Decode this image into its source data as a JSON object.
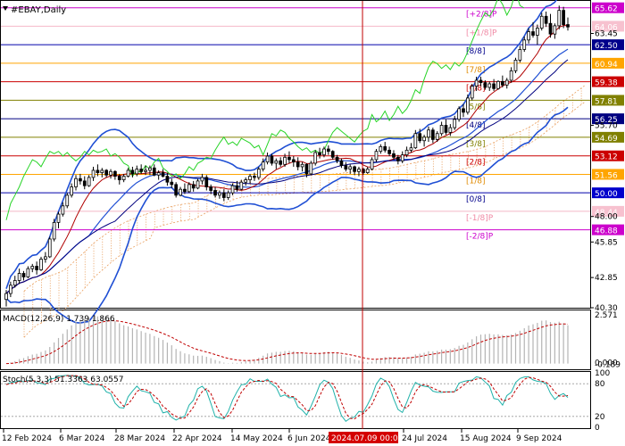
{
  "chart_data": {
    "type": "candlestick",
    "title": "#EBAY,Daily",
    "price_axis": {
      "labels": [
        "65.62",
        "64.06",
        "63.45",
        "62.50",
        "60.94",
        "59.38",
        "57.81",
        "56.25",
        "55.70",
        "54.69",
        "53.12",
        "51.56",
        "50.00",
        "48.44",
        "48.00",
        "46.88",
        "45.85",
        "42.85",
        "40.30"
      ],
      "ylim": [
        40.3,
        66.2
      ]
    },
    "murrey_levels": [
      {
        "label": "[+2/8]P",
        "price": 65.62,
        "color": "#cc00cc",
        "tag_bg": "#cc00cc",
        "label_color": "#cc00cc"
      },
      {
        "label": "[+1/8]P",
        "price": 64.06,
        "color": "#f4b8c8",
        "tag_bg": "#f7c1cf",
        "label_color": "#f08aa5"
      },
      {
        "label": "[8/8]",
        "price": 62.5,
        "color": "#0000aa",
        "tag_bg": "#00008b",
        "label_color": "#00008b"
      },
      {
        "label": "[7/8]",
        "price": 60.94,
        "color": "#ffa500",
        "tag_bg": "#ffa500",
        "label_color": "#e08a00"
      },
      {
        "label": "[6/8]",
        "price": 59.38,
        "color": "#cc0000",
        "tag_bg": "#cc0000",
        "label_color": "#cc0000"
      },
      {
        "label": "[5/8]",
        "price": 57.81,
        "color": "#808000",
        "tag_bg": "#808000",
        "label_color": "#808000"
      },
      {
        "label": "[4/8]",
        "price": 56.25,
        "color": "#000080",
        "tag_bg": "#000080",
        "label_color": "#000080"
      },
      {
        "label": "[3/8]",
        "price": 54.69,
        "color": "#808000",
        "tag_bg": "#808000",
        "label_color": "#808000"
      },
      {
        "label": "[2/8]",
        "price": 53.12,
        "color": "#cc0000",
        "tag_bg": "#cc0000",
        "label_color": "#cc0000"
      },
      {
        "label": "[1/8]",
        "price": 51.56,
        "color": "#ffa500",
        "tag_bg": "#ffa500",
        "label_color": "#e08a00"
      },
      {
        "label": "[0/8]",
        "price": 50.0,
        "color": "#0000aa",
        "tag_bg": "#0000cc",
        "label_color": "#00008b"
      },
      {
        "label": "[-1/8]P",
        "price": 48.44,
        "color": "#f4b8c8",
        "tag_bg": "#f7c1cf",
        "label_color": "#f08aa5"
      },
      {
        "label": "[-2/8]P",
        "price": 46.88,
        "color": "#cc00cc",
        "tag_bg": "#cc00cc",
        "label_color": "#cc00cc"
      }
    ],
    "x_labels": [
      "12 Feb 2024",
      "6 Mar 2024",
      "28 Mar 2024",
      "22 Apr 2024",
      "14 May 2024",
      "6 Jun 2024",
      "24 Jul 2024",
      "15 Aug 2024",
      "9 Sep 2024"
    ],
    "highlight_date": "2024.07.09 00:00",
    "candles": [
      [
        41.0,
        41.8,
        40.4,
        41.5
      ],
      [
        41.5,
        42.5,
        41.2,
        42.2
      ],
      [
        42.2,
        43.0,
        42.0,
        42.6
      ],
      [
        42.6,
        43.6,
        42.3,
        43.2
      ],
      [
        43.2,
        43.4,
        42.6,
        42.9
      ],
      [
        42.9,
        43.8,
        42.8,
        43.6
      ],
      [
        43.6,
        44.0,
        43.3,
        43.8
      ],
      [
        43.8,
        44.2,
        43.1,
        43.5
      ],
      [
        43.5,
        44.6,
        43.4,
        44.4
      ],
      [
        44.4,
        45.0,
        44.1,
        44.6
      ],
      [
        44.6,
        46.3,
        44.5,
        46.1
      ],
      [
        46.1,
        47.8,
        45.9,
        47.5
      ],
      [
        47.5,
        48.4,
        47.0,
        48.2
      ],
      [
        48.2,
        49.2,
        48.0,
        48.9
      ],
      [
        48.9,
        50.0,
        48.7,
        49.8
      ],
      [
        49.8,
        50.8,
        49.6,
        50.5
      ],
      [
        50.5,
        51.5,
        50.2,
        51.2
      ],
      [
        51.2,
        51.6,
        50.7,
        51.0
      ],
      [
        51.0,
        51.4,
        50.3,
        50.6
      ],
      [
        50.6,
        51.5,
        50.5,
        51.3
      ],
      [
        51.3,
        52.2,
        51.0,
        51.9
      ],
      [
        51.9,
        52.4,
        51.4,
        51.7
      ],
      [
        51.7,
        52.1,
        51.3,
        51.9
      ],
      [
        51.9,
        52.0,
        51.3,
        51.5
      ],
      [
        51.5,
        52.0,
        51.2,
        51.8
      ],
      [
        51.8,
        51.9,
        51.1,
        51.4
      ],
      [
        51.4,
        51.6,
        50.7,
        51.1
      ],
      [
        51.1,
        51.6,
        50.9,
        51.4
      ],
      [
        51.4,
        52.1,
        51.3,
        51.9
      ],
      [
        51.9,
        52.2,
        51.3,
        51.6
      ],
      [
        51.6,
        52.3,
        51.4,
        52.0
      ],
      [
        52.0,
        52.4,
        51.6,
        51.8
      ],
      [
        51.8,
        52.3,
        51.5,
        51.9
      ],
      [
        51.9,
        52.3,
        51.5,
        52.1
      ],
      [
        52.1,
        52.4,
        51.4,
        51.5
      ],
      [
        51.5,
        51.9,
        51.1,
        51.7
      ],
      [
        51.7,
        52.0,
        51.3,
        51.4
      ],
      [
        51.4,
        51.7,
        50.6,
        50.9
      ],
      [
        50.9,
        51.2,
        50.4,
        50.7
      ],
      [
        50.7,
        50.9,
        49.6,
        49.8
      ],
      [
        49.8,
        50.5,
        49.7,
        50.3
      ],
      [
        50.3,
        50.8,
        49.9,
        50.1
      ],
      [
        50.1,
        50.9,
        50.0,
        50.7
      ],
      [
        50.7,
        51.0,
        50.1,
        50.4
      ],
      [
        50.4,
        51.2,
        50.3,
        51.0
      ],
      [
        51.0,
        51.6,
        50.7,
        51.3
      ],
      [
        51.3,
        51.5,
        50.2,
        50.5
      ],
      [
        50.5,
        50.7,
        49.9,
        50.2
      ],
      [
        50.2,
        50.5,
        49.6,
        49.8
      ],
      [
        49.8,
        50.2,
        49.5,
        50.0
      ],
      [
        50.0,
        50.3,
        49.3,
        49.6
      ],
      [
        49.6,
        50.2,
        49.4,
        50.0
      ],
      [
        50.0,
        50.8,
        49.8,
        50.6
      ],
      [
        50.6,
        51.0,
        50.1,
        50.3
      ],
      [
        50.3,
        51.1,
        50.2,
        50.9
      ],
      [
        50.9,
        51.3,
        50.6,
        51.1
      ],
      [
        51.1,
        51.6,
        50.8,
        51.4
      ],
      [
        51.4,
        51.7,
        51.0,
        51.3
      ],
      [
        51.3,
        52.2,
        51.1,
        52.0
      ],
      [
        52.0,
        52.9,
        51.8,
        52.6
      ],
      [
        52.6,
        53.4,
        52.4,
        53.1
      ],
      [
        53.1,
        53.3,
        52.3,
        52.5
      ],
      [
        52.5,
        52.9,
        52.0,
        52.7
      ],
      [
        52.7,
        53.0,
        52.2,
        52.4
      ],
      [
        52.4,
        53.3,
        52.2,
        53.0
      ],
      [
        53.0,
        53.5,
        52.5,
        52.8
      ],
      [
        52.8,
        53.1,
        52.2,
        52.6
      ],
      [
        52.6,
        53.0,
        51.9,
        52.2
      ],
      [
        52.2,
        52.6,
        51.8,
        52.4
      ],
      [
        52.4,
        52.5,
        51.3,
        51.6
      ],
      [
        51.6,
        52.7,
        51.5,
        52.5
      ],
      [
        52.5,
        53.6,
        52.3,
        53.4
      ],
      [
        53.4,
        53.8,
        52.9,
        53.2
      ],
      [
        53.2,
        53.9,
        53.0,
        53.7
      ],
      [
        53.7,
        54.0,
        53.2,
        53.5
      ],
      [
        53.5,
        53.6,
        52.8,
        53.0
      ],
      [
        53.0,
        53.2,
        52.5,
        52.7
      ],
      [
        52.7,
        52.9,
        52.1,
        52.3
      ],
      [
        52.3,
        52.6,
        51.8,
        52.0
      ],
      [
        52.0,
        52.4,
        51.6,
        52.2
      ],
      [
        52.2,
        52.3,
        51.5,
        51.8
      ],
      [
        51.8,
        52.2,
        51.4,
        52.0
      ],
      [
        52.0,
        52.1,
        51.5,
        51.7
      ],
      [
        51.7,
        52.2,
        51.6,
        52.0
      ],
      [
        52.0,
        53.0,
        51.9,
        52.8
      ],
      [
        52.8,
        53.7,
        52.6,
        53.5
      ],
      [
        53.5,
        54.1,
        53.3,
        53.9
      ],
      [
        53.9,
        54.3,
        53.4,
        53.6
      ],
      [
        53.6,
        53.9,
        53.1,
        53.3
      ],
      [
        53.3,
        53.6,
        52.8,
        53.0
      ],
      [
        53.0,
        53.2,
        52.4,
        52.7
      ],
      [
        52.7,
        53.5,
        52.5,
        53.2
      ],
      [
        53.2,
        53.9,
        53.0,
        53.6
      ],
      [
        53.6,
        54.2,
        53.4,
        53.8
      ],
      [
        53.8,
        55.3,
        53.7,
        55.0
      ],
      [
        55.0,
        55.4,
        54.2,
        54.4
      ],
      [
        54.4,
        54.9,
        53.9,
        54.7
      ],
      [
        54.7,
        55.6,
        54.3,
        55.3
      ],
      [
        55.3,
        55.5,
        54.2,
        54.5
      ],
      [
        54.5,
        55.2,
        54.3,
        55.0
      ],
      [
        55.0,
        56.0,
        54.8,
        55.7
      ],
      [
        55.7,
        56.2,
        54.9,
        55.1
      ],
      [
        55.1,
        55.8,
        54.8,
        55.5
      ],
      [
        55.5,
        56.5,
        55.3,
        56.2
      ],
      [
        56.2,
        57.3,
        56.0,
        57.1
      ],
      [
        57.1,
        57.5,
        56.4,
        56.8
      ],
      [
        56.8,
        58.3,
        56.6,
        58.0
      ],
      [
        58.0,
        59.2,
        57.8,
        59.0
      ],
      [
        59.0,
        59.8,
        58.6,
        59.5
      ],
      [
        59.5,
        59.8,
        59.0,
        59.3
      ],
      [
        59.3,
        59.5,
        58.7,
        58.9
      ],
      [
        58.9,
        59.4,
        58.6,
        59.2
      ],
      [
        59.2,
        59.6,
        58.6,
        58.8
      ],
      [
        58.8,
        59.5,
        58.7,
        59.4
      ],
      [
        59.4,
        59.9,
        58.9,
        59.1
      ],
      [
        59.1,
        59.7,
        58.8,
        59.5
      ],
      [
        59.5,
        60.6,
        59.3,
        60.3
      ],
      [
        60.3,
        61.4,
        60.1,
        61.2
      ],
      [
        61.2,
        62.4,
        61.0,
        62.1
      ],
      [
        62.1,
        63.2,
        61.9,
        62.9
      ],
      [
        62.9,
        63.9,
        62.6,
        63.6
      ],
      [
        63.6,
        64.4,
        63.1,
        63.3
      ],
      [
        63.3,
        64.2,
        62.5,
        63.9
      ],
      [
        63.9,
        65.2,
        63.7,
        64.9
      ],
      [
        64.9,
        65.3,
        64.0,
        64.3
      ],
      [
        64.3,
        65.1,
        63.1,
        63.4
      ],
      [
        63.4,
        64.3,
        63.0,
        64.1
      ],
      [
        64.1,
        65.8,
        63.8,
        65.4
      ],
      [
        65.4,
        65.7,
        63.9,
        64.2
      ],
      [
        64.2,
        64.8,
        63.7,
        64.0
      ]
    ],
    "macd": {
      "label": "MACD(12,26,9) 1.739 1.866",
      "axis_labels": [
        "2.571",
        "0.000",
        "-0.189"
      ],
      "ylim": [
        -0.3,
        2.75
      ]
    },
    "stoch": {
      "label": "Stoch(5,3,3) 51.3363 63.0557",
      "axis_labels": [
        "100",
        "80",
        "20",
        "0"
      ],
      "ylim": [
        0,
        100
      ]
    }
  },
  "colors": {
    "candle": "#000000",
    "ma_red": "#b00000",
    "ma_navy": "#00007f",
    "bollinger": "#1f4fd4",
    "chikou": "#27d427",
    "cloud": "#e9a060",
    "macd_hist": "#b4b4b4",
    "macd_signal": "#c00000",
    "stoch_main": "#20b2aa",
    "stoch_signal": "#c00000",
    "highlight_line": "#c00000",
    "highlight_tag_bg": "#d40000"
  }
}
